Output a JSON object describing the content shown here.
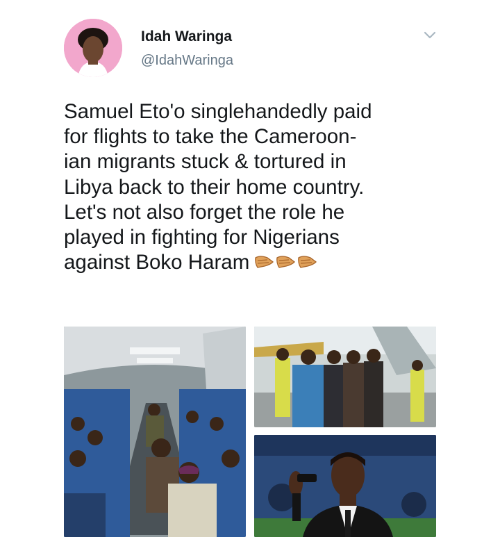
{
  "author": {
    "display_name": "Idah Waringa",
    "handle": "@IdahWaringa"
  },
  "tweet": {
    "lines": [
      "Samuel Eto'o singlehandedly paid",
      "for flights to take the Cameroon-",
      "ian migrants stuck & tortured in",
      "Libya back to their home country.",
      "Let's not also forget the role he",
      "played in fighting for Nigerians",
      "against Boko Haram"
    ],
    "emoji": [
      "clapping-hands-icon",
      "clapping-hands-icon",
      "clapping-hands-icon"
    ]
  },
  "media": {
    "count": 3,
    "items": [
      "airplane-cabin-photo",
      "airport-migrants-photo",
      "samuel-etoo-photo"
    ]
  },
  "colors": {
    "text": "#14171a",
    "handle": "#657786",
    "avatar_bg": "#f2a7cc",
    "chevron": "#aab8c2",
    "emoji_skin": "#e0a15a"
  }
}
